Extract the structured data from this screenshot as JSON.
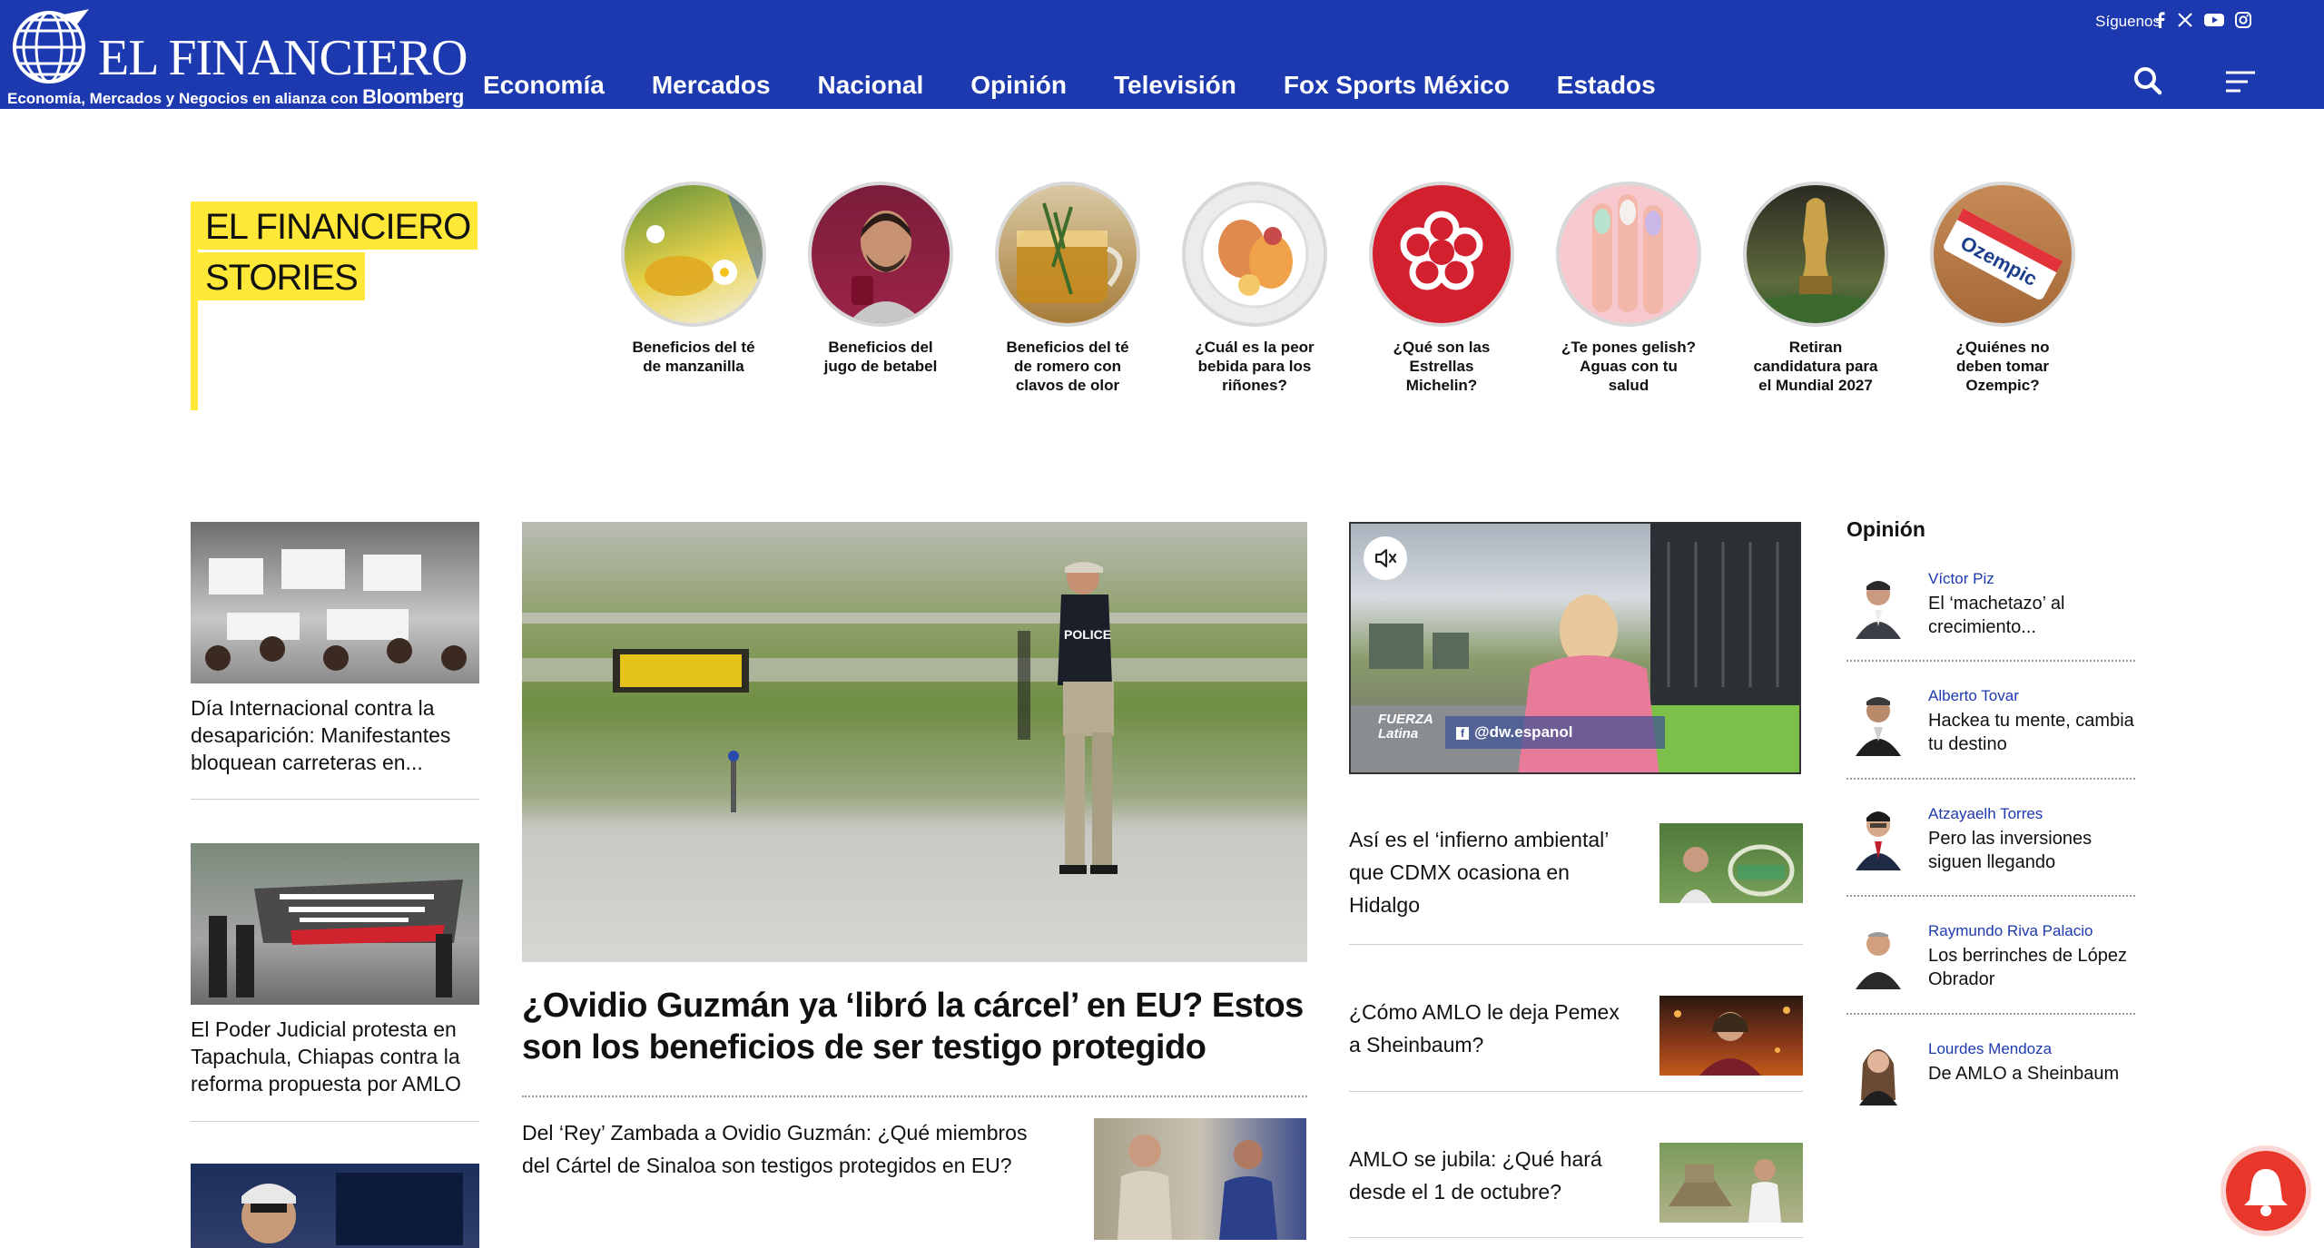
{
  "header": {
    "logo_text": "EL FINANCIERO",
    "tagline": "Economía, Mercados y Negocios en alianza con",
    "tagline_brand": "Bloomberg",
    "follow_label": "Síguenos",
    "social": [
      "facebook-icon",
      "x-icon",
      "youtube-icon",
      "instagram-icon"
    ],
    "nav": [
      "Economía",
      "Mercados",
      "Nacional",
      "Opinión",
      "Televisión",
      "Fox Sports México",
      "Estados"
    ]
  },
  "stories": {
    "title_line1": "EL FINANCIERO",
    "title_line2": "STORIES",
    "items": [
      {
        "caption": "Beneficios del té de manzanilla"
      },
      {
        "caption": "Beneficios del jugo de betabel"
      },
      {
        "caption": "Beneficios del té de romero con clavos de olor"
      },
      {
        "caption": "¿Cuál es la peor bebida para los riñones?"
      },
      {
        "caption": "¿Qué son las Estrellas Michelin?"
      },
      {
        "caption": "¿Te pones gelish? Aguas con tu salud"
      },
      {
        "caption": "Retiran candidatura para el Mundial 2027"
      },
      {
        "caption": "¿Quiénes no deben tomar Ozempic?"
      }
    ]
  },
  "left_column": [
    {
      "title": "Día Internacional contra la desaparición: Manifestantes bloquean carreteras en..."
    },
    {
      "title": "El Poder Judicial protesta en Tapachula, Chiapas contra la reforma propuesta por AMLO"
    },
    {
      "title": ""
    }
  ],
  "main": {
    "headline": "¿Ovidio Guzmán ya ‘libró la cárcel’ en EU? Estos son los beneficios de ser testigo protegido",
    "related": "Del ‘Rey’ Zambada a Ovidio Guzmán: ¿Qué miembros del Cártel de Sinaloa son testigos protegidos en EU?",
    "image_sign": "POLICE"
  },
  "video": {
    "handle": "@dw.espanol",
    "badge_line1": "FUERZA",
    "badge_line2": "Latina"
  },
  "right_center": [
    {
      "title": "Así es el ‘infierno ambiental’ que CDMX ocasiona en Hidalgo"
    },
    {
      "title": "¿Cómo AMLO le deja Pemex a Sheinbaum?"
    },
    {
      "title": "AMLO se jubila: ¿Qué hará desde el 1 de octubre?"
    }
  ],
  "opinion": {
    "heading": "Opinión",
    "items": [
      {
        "author": "Víctor Piz",
        "title": "El ‘machetazo’ al crecimiento..."
      },
      {
        "author": "Alberto Tovar",
        "title": "Hackea tu mente, cambia tu destino"
      },
      {
        "author": "Atzayaelh Torres",
        "title": "Pero las inversiones siguen llegando"
      },
      {
        "author": "Raymundo Riva Palacio",
        "title": "Los berrinches de López Obrador"
      },
      {
        "author": "Lourdes Mendoza",
        "title": "De AMLO a Sheinbaum"
      }
    ]
  },
  "colors": {
    "brand_blue": "#1d39b0",
    "stories_yellow": "#ffe838",
    "bell_red": "#e8362a"
  }
}
